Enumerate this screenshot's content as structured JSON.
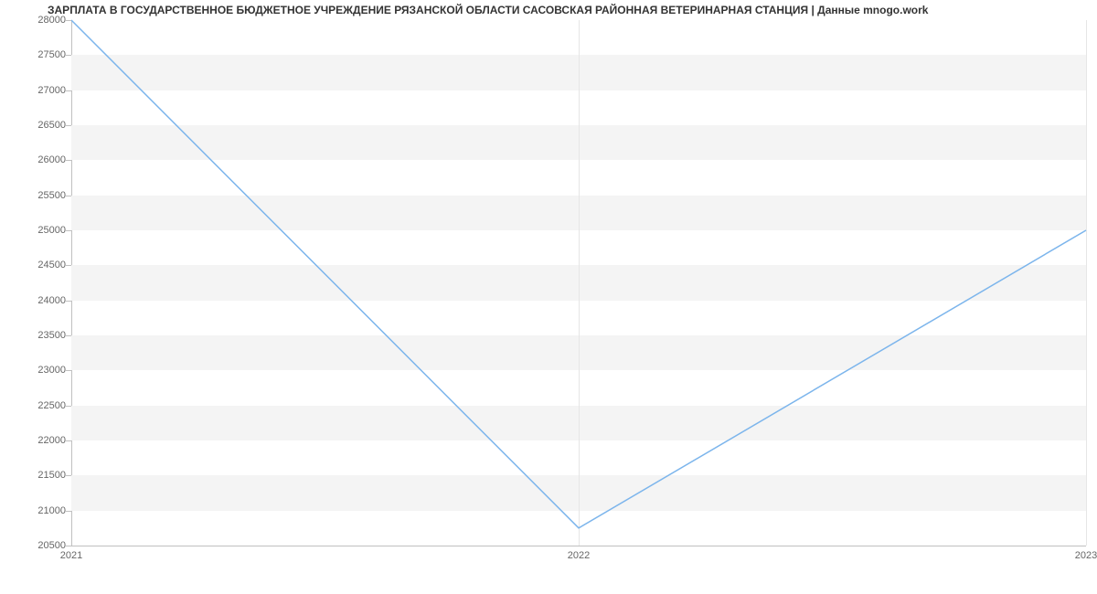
{
  "chart_data": {
    "type": "line",
    "title": "ЗАРПЛАТА В ГОСУДАРСТВЕННОЕ БЮДЖЕТНОЕ УЧРЕЖДЕНИЕ РЯЗАНСКОЙ ОБЛАСТИ САСОВСКАЯ РАЙОННАЯ ВЕТЕРИНАРНАЯ СТАНЦИЯ | Данные mnogo.work",
    "x": [
      2021,
      2022,
      2023
    ],
    "values": [
      28000,
      20750,
      25000
    ],
    "xlabel": "",
    "ylabel": "",
    "ylim": [
      20500,
      28000
    ],
    "y_ticks": [
      20500,
      21000,
      21500,
      22000,
      22500,
      23000,
      23500,
      24000,
      24500,
      25000,
      25500,
      26000,
      26500,
      27000,
      27500,
      28000
    ],
    "x_ticks": [
      2021,
      2022,
      2023
    ],
    "line_color": "#7cb5ec"
  }
}
